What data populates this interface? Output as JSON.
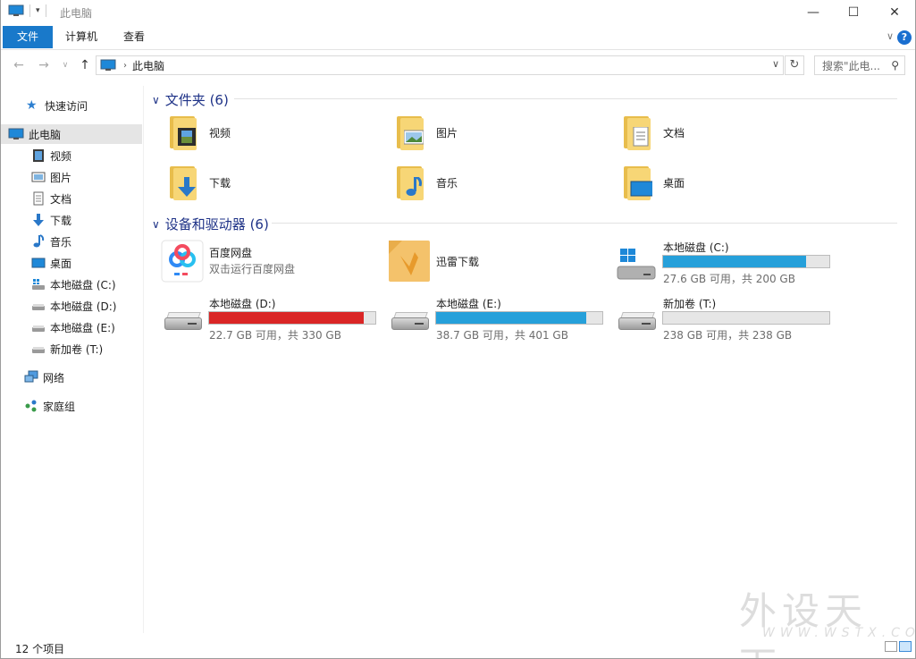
{
  "window": {
    "title": "此电脑",
    "controls": {
      "minimize": "—",
      "maximize": "☐",
      "close": "✕"
    }
  },
  "ribbon": {
    "tabs": [
      "文件",
      "计算机",
      "查看"
    ],
    "help": "?"
  },
  "address": {
    "crumb": "此电脑",
    "search_placeholder": "搜索\"此电..."
  },
  "nav": {
    "quick_access": "快速访问",
    "this_pc": "此电脑",
    "items": [
      "视频",
      "图片",
      "文档",
      "下载",
      "音乐",
      "桌面",
      "本地磁盘 (C:)",
      "本地磁盘 (D:)",
      "本地磁盘 (E:)",
      "新加卷 (T:)"
    ],
    "network": "网络",
    "homegroup": "家庭组"
  },
  "folders_group": {
    "title": "文件夹 (6)",
    "folders": [
      {
        "name": "视频",
        "icon": "video-icon"
      },
      {
        "name": "图片",
        "icon": "picture-icon"
      },
      {
        "name": "文档",
        "icon": "document-icon"
      },
      {
        "name": "下载",
        "icon": "download-icon"
      },
      {
        "name": "音乐",
        "icon": "music-icon"
      },
      {
        "name": "桌面",
        "icon": "desktop-icon"
      }
    ]
  },
  "devices_group": {
    "title": "设备和驱动器 (6)",
    "apps": [
      {
        "name": "百度网盘",
        "subtitle": "双击运行百度网盘",
        "icon": "baidu-netdisk-icon"
      },
      {
        "name": "迅雷下载",
        "subtitle": "",
        "icon": "xunlei-icon"
      }
    ],
    "drives": [
      {
        "name": "本地磁盘 (C:)",
        "info": "27.6 GB 可用，共 200 GB",
        "used_fraction": 0.862,
        "bar_color": "#26a0da",
        "system": true
      },
      {
        "name": "本地磁盘 (D:)",
        "info": "22.7 GB 可用，共 330 GB",
        "used_fraction": 0.931,
        "bar_color": "#da2626",
        "system": false
      },
      {
        "name": "本地磁盘 (E:)",
        "info": "38.7 GB 可用，共 401 GB",
        "used_fraction": 0.903,
        "bar_color": "#26a0da",
        "system": false
      },
      {
        "name": "新加卷 (T:)",
        "info": "238 GB 可用，共 238 GB",
        "used_fraction": 0.0,
        "bar_color": "#26a0da",
        "system": false
      }
    ]
  },
  "status": {
    "count": "12 个项目"
  },
  "watermark": {
    "big": "外设天下",
    "small": "WWW.WSTX.COM"
  }
}
